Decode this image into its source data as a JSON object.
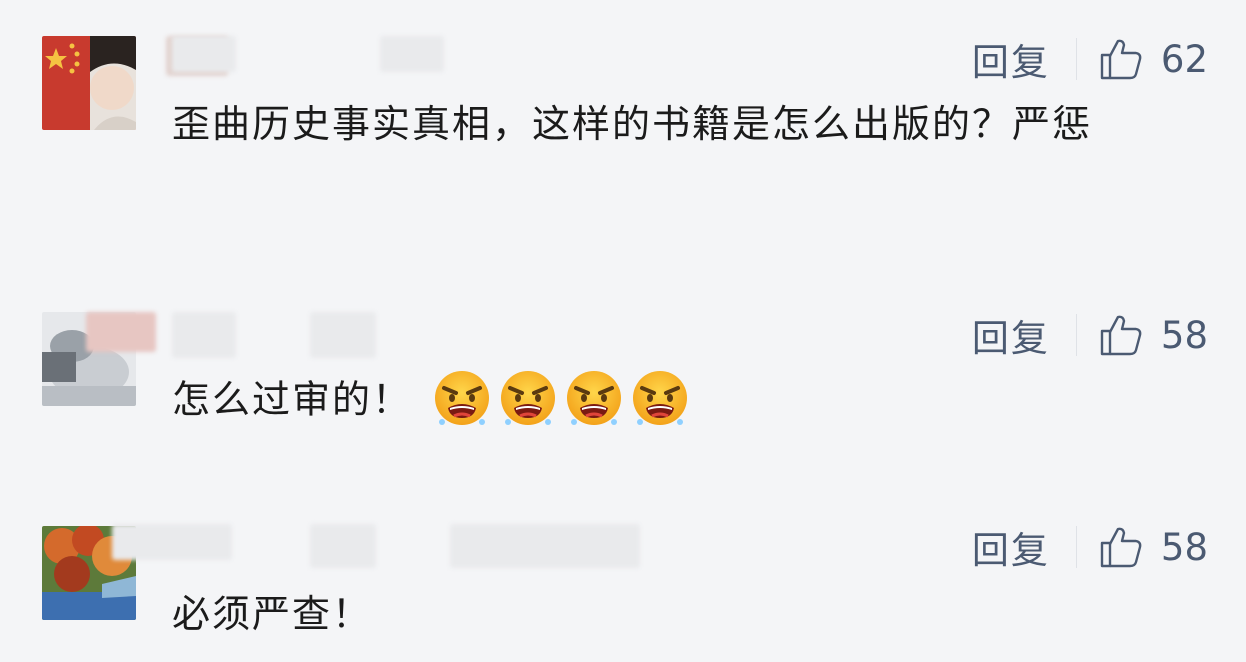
{
  "comments": [
    {
      "avatar_icon": "avatar-icon",
      "reply_label": "回复",
      "like_count": "62",
      "text": "歪曲历史事实真相，这样的书籍是怎么出版的？严惩",
      "emojis": []
    },
    {
      "avatar_icon": "avatar-icon",
      "reply_label": "回复",
      "like_count": "58",
      "text": "怎么过审的！",
      "emojis": [
        "angry-face-emoji",
        "angry-face-emoji",
        "angry-face-emoji",
        "angry-face-emoji"
      ]
    },
    {
      "avatar_icon": "avatar-icon",
      "reply_label": "回复",
      "like_count": "58",
      "text": "必须严查！",
      "emojis": []
    }
  ],
  "colors": {
    "background": "#f4f5f7",
    "action_text": "#4b5a72",
    "content_text": "#1b1b1b"
  }
}
